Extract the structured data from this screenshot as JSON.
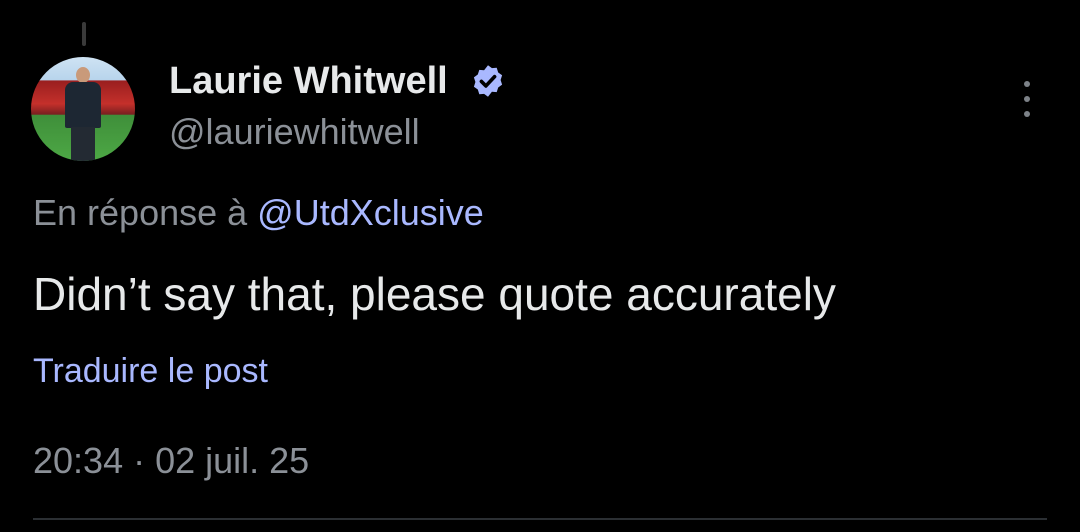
{
  "author": {
    "display_name": "Laurie Whitwell",
    "handle": "@lauriewhitwell",
    "verified": true,
    "avatar_icon": "profile-photo"
  },
  "reply": {
    "prefix": "En réponse à ",
    "mention": "@UtdXclusive"
  },
  "post": {
    "text": "Didn’t say that, please quote accurately",
    "translate_label": "Traduire le post",
    "timestamp": "20:34 · 02 juil. 25"
  },
  "colors": {
    "background": "#000000",
    "primary_text": "#e7e9ea",
    "secondary_text": "#8b9097",
    "link": "#a9b8ff",
    "verified_badge": "#a9b8ff"
  },
  "icons": {
    "verified": "verified-badge-icon",
    "more": "more-options-icon"
  }
}
